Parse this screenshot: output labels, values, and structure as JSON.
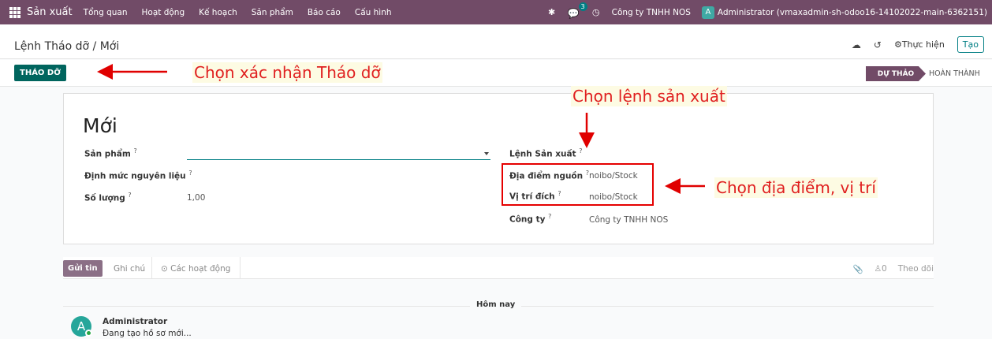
{
  "navbar": {
    "app_name": "Sản xuất",
    "menu": [
      "Tổng quan",
      "Hoạt động",
      "Kế hoạch",
      "Sản phẩm",
      "Báo cáo",
      "Cấu hình"
    ],
    "chat_count": "3",
    "company": "Công ty TNHH NOS",
    "avatar_letter": "A",
    "user": "Administrator (vmaxadmin-sh-odoo16-14102022-main-6362151)"
  },
  "breadcrumb": "Lệnh Tháo dỡ / Mới",
  "actions": {
    "action_label": "⚙Thực hiện",
    "create_label": "Tạo"
  },
  "statusbar": {
    "button_label": "THÁO DỠ",
    "state_draft": "DỰ THẢO",
    "state_done": "HOÀN THÀNH"
  },
  "form": {
    "title": "Mới",
    "product_label": "Sản phẩm",
    "product_value": "",
    "bom_label": "Định mức nguyên liệu",
    "qty_label": "Số lượng",
    "qty_value": "1,00",
    "mo_label": "Lệnh Sản xuất",
    "src_label": "Địa điểm nguồn",
    "src_value": "noibo/Stock",
    "dest_label": "Vị trí đích",
    "dest_value": "noibo/Stock",
    "company_label": "Công ty",
    "company_value": "Công ty TNHH NOS",
    "help_mark": "?"
  },
  "chatter": {
    "send_label": "Gửi tin",
    "note_label": "Ghi chú",
    "activity_label": "⊙ Các hoạt động",
    "followers": "0",
    "follow_label": "Theo dõi",
    "day_label": "Hôm nay",
    "author_initial": "A",
    "author": "Administrator",
    "message": "Đang tạo hồ sơ mới..."
  },
  "annotations": {
    "confirm": "Chọn xác nhận Tháo dỡ",
    "production_order": "Chọn lệnh sản xuất",
    "location": "Chọn địa điểm, vị trí"
  },
  "colors": {
    "brand": "#714b67",
    "primary": "#00655e",
    "annotation": "#e02020"
  }
}
